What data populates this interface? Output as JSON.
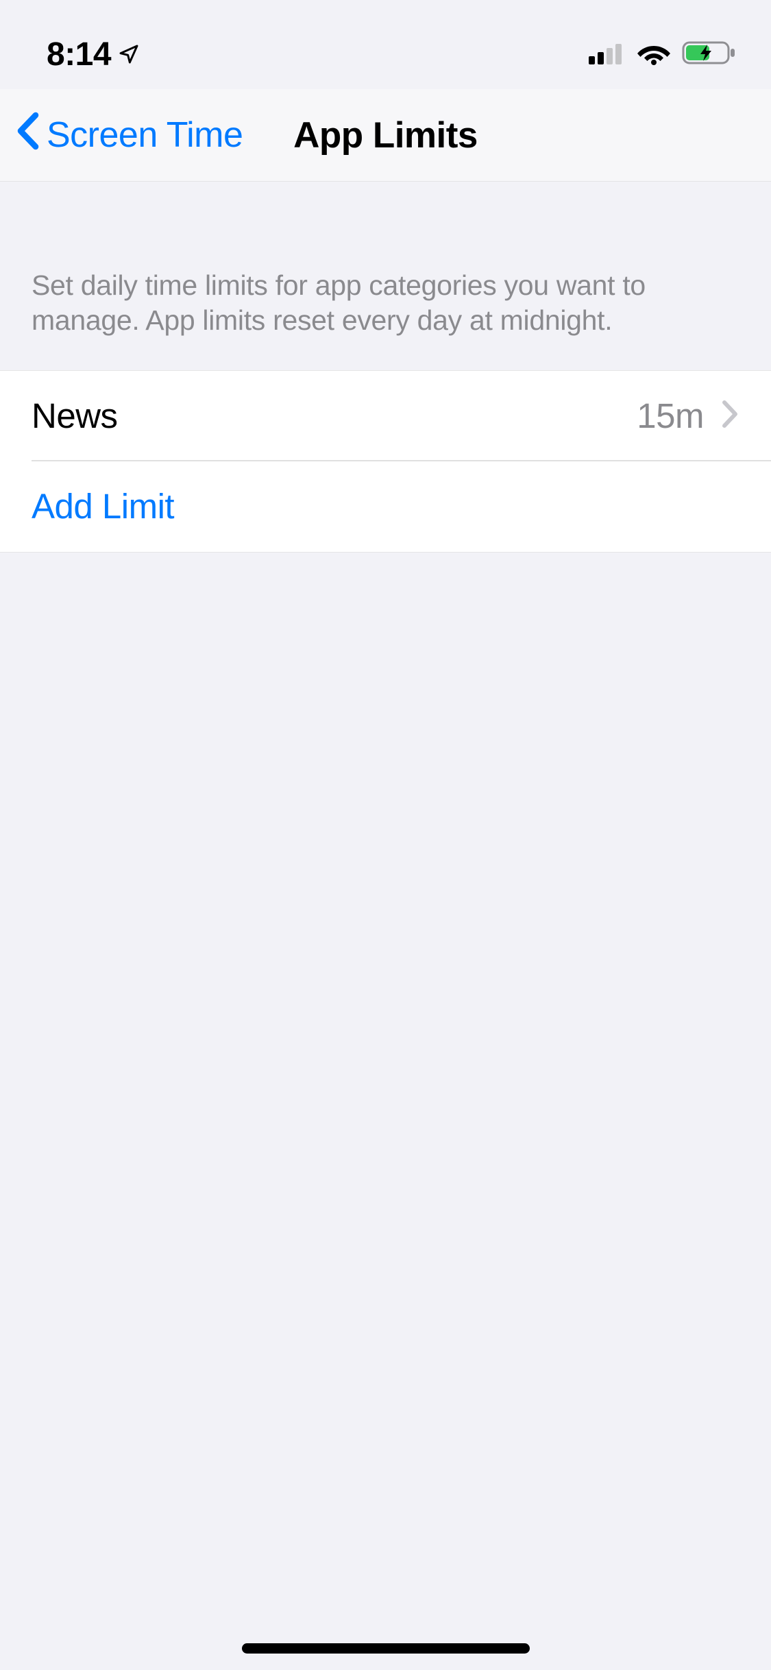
{
  "status": {
    "time": "8:14"
  },
  "nav": {
    "back_label": "Screen Time",
    "title": "App Limits"
  },
  "section": {
    "description": "Set daily time limits for app categories you want to manage. App limits reset every day at midnight."
  },
  "limits": [
    {
      "name": "News",
      "duration": "15m"
    }
  ],
  "actions": {
    "add_label": "Add Limit"
  },
  "colors": {
    "tint": "#007aff",
    "background": "#f2f2f7",
    "row_bg": "#ffffff",
    "secondary_text": "#8a8a8e"
  }
}
